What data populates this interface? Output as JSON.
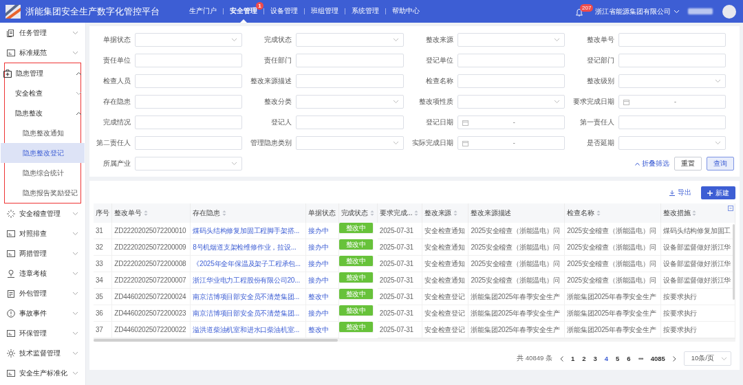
{
  "app": {
    "title": "浙能集团安全生产数字化管控平台"
  },
  "top_nav": [
    {
      "label": "生产门户",
      "selected": false
    },
    {
      "label": "安全管理",
      "selected": true,
      "badge": "1"
    },
    {
      "label": "设备管理",
      "selected": false
    },
    {
      "label": "班组管理",
      "selected": false
    },
    {
      "label": "系统管理",
      "selected": false
    },
    {
      "label": "帮助中心",
      "selected": false
    }
  ],
  "header_right": {
    "notification_count": "207",
    "company": "浙江省能源集团有限公司"
  },
  "sidebar": {
    "items": [
      {
        "label": "任务管理",
        "expanded": false
      },
      {
        "label": "标准规范",
        "expanded": false
      },
      {
        "label": "隐患管理",
        "expanded": true,
        "highlighted": true,
        "children": [
          {
            "label": "安全检查",
            "expanded": false
          },
          {
            "label": "隐患整改",
            "expanded": true,
            "children": [
              {
                "label": "隐患整改通知",
                "selected": false
              },
              {
                "label": "隐患整改登记",
                "selected": true
              },
              {
                "label": "隐患综合统计",
                "selected": false
              },
              {
                "label": "隐患报告奖励登记",
                "selected": false
              }
            ]
          }
        ]
      },
      {
        "label": "安全稽查管理",
        "expanded": false
      },
      {
        "label": "对照排查",
        "expanded": false
      },
      {
        "label": "两措管理",
        "expanded": false
      },
      {
        "label": "违章考核",
        "expanded": false
      },
      {
        "label": "外包管理",
        "expanded": false
      },
      {
        "label": "事故事件",
        "expanded": false
      },
      {
        "label": "环保管理",
        "expanded": false
      },
      {
        "label": "技术监督管理",
        "expanded": false
      },
      {
        "label": "安全生产标准化",
        "expanded": false
      }
    ]
  },
  "filters": {
    "fields": [
      {
        "label": "单据状态",
        "kind": "select"
      },
      {
        "label": "完成状态",
        "kind": "select"
      },
      {
        "label": "整改来源",
        "kind": "select"
      },
      {
        "label": "整改单号",
        "kind": "text"
      },
      {
        "label": "责任单位",
        "kind": "text"
      },
      {
        "label": "责任部门",
        "kind": "text"
      },
      {
        "label": "登记单位",
        "kind": "text"
      },
      {
        "label": "登记部门",
        "kind": "text"
      },
      {
        "label": "检查人员",
        "kind": "text"
      },
      {
        "label": "整改来源描述",
        "kind": "text"
      },
      {
        "label": "检查名称",
        "kind": "text"
      },
      {
        "label": "整改级别",
        "kind": "select"
      },
      {
        "label": "存在隐患",
        "kind": "text"
      },
      {
        "label": "整改分类",
        "kind": "select"
      },
      {
        "label": "整改项性质",
        "kind": "select"
      },
      {
        "label": "要求完成日期",
        "kind": "date",
        "separator": "-"
      },
      {
        "label": "完成情况",
        "kind": "text"
      },
      {
        "label": "登记人",
        "kind": "text"
      },
      {
        "label": "登记日期",
        "kind": "date",
        "separator": "-"
      },
      {
        "label": "第一责任人",
        "kind": "text"
      },
      {
        "label": "第二责任人",
        "kind": "text"
      },
      {
        "label": "管理隐患类别",
        "kind": "select"
      },
      {
        "label": "实际完成日期",
        "kind": "date",
        "separator": "-"
      },
      {
        "label": "是否延期",
        "kind": "select"
      },
      {
        "label": "所属产业",
        "kind": "select"
      }
    ],
    "collapse_link": "折叠筛选",
    "buttons": [
      {
        "label": "重置",
        "kind": "default"
      },
      {
        "label": "查询",
        "kind": "primary"
      }
    ]
  },
  "table": {
    "toolbar": {
      "export": "导出",
      "create": "新建"
    },
    "columns": [
      {
        "label": "序号",
        "sortable": false,
        "kind": "text"
      },
      {
        "label": "整改单号",
        "sortable": true,
        "kind": "text"
      },
      {
        "label": "存在隐患",
        "sortable": true,
        "kind": "link"
      },
      {
        "label": "单据状态",
        "sortable": false,
        "kind": "status"
      },
      {
        "label": "完成状态",
        "sortable": true,
        "kind": "tag"
      },
      {
        "label": "要求完成...",
        "sortable": true,
        "kind": "text"
      },
      {
        "label": "整改来源",
        "sortable": true,
        "kind": "text"
      },
      {
        "label": "整改来源描述",
        "sortable": false,
        "kind": "text"
      },
      {
        "label": "检查名称",
        "sortable": true,
        "kind": "text"
      },
      {
        "label": "整改措施",
        "sortable": true,
        "kind": "text"
      }
    ],
    "rows": [
      [
        "31",
        "ZD22202025072200010",
        "煤码头结构修复加固工程脚手架搭...",
        "接办中",
        "整改中",
        "2025-07-31",
        "安全检查通知",
        "2025安全稽查（浙能温电）问",
        "2025安全稽查（浙能温电）问",
        "煤码头结构修复加固工"
      ],
      [
        "32",
        "ZD22202025072200009",
        "8号机烟道支架检维修作业，拉设...",
        "接办中",
        "整改中",
        "2025-07-31",
        "安全检查通知",
        "2025安全稽查（浙能温电）问",
        "2025安全稽查（浙能温电）问",
        "设备部监督做好浙江华"
      ],
      [
        "33",
        "ZD22202025072200008",
        "《2025年全年保温及架子工程承包...",
        "接办中",
        "整改中",
        "2025-07-31",
        "安全检查通知",
        "2025安全稽查（浙能温电）问",
        "2025安全稽查（浙能温电）问",
        "设备部监督做好浙江华"
      ],
      [
        "34",
        "ZD22202025072200007",
        "浙江华业电力工程股份有限公司20...",
        "接办中",
        "整改中",
        "2025-07-31",
        "安全检查通知",
        "2025安全稽查（浙能温电）问",
        "2025安全稽查（浙能温电）问",
        "设备部监督做好浙江华"
      ],
      [
        "35",
        "ZD44602025072200024",
        "南京洁博项目部安全员不清楚集团...",
        "整改中",
        "整改中",
        "2025-07-31",
        "安全检查登记",
        "浙能集团2025年春季安全生产",
        "浙能集团2025年春季安全生产",
        "按要求执行"
      ],
      [
        "36",
        "ZD44602025072200023",
        "南京洁博项目部安全员不清楚集团...",
        "接办中",
        "整改中",
        "2025-07-31",
        "安全检查登记",
        "浙能集团2025年春季安全生产",
        "浙能集团2025年春季安全生产",
        "按要求执行"
      ],
      [
        "37",
        "ZD44602025072200022",
        "溢洪道柴油机室和进水口柴油机室...",
        "整改中",
        "整改中",
        "2025-07-31",
        "安全检查登记",
        "浙能集团2025年春季安全生产",
        "浙能集团2025年春季安全生产",
        "按要求执行"
      ]
    ]
  },
  "pagination": {
    "total": "共 40849 条",
    "pages": [
      {
        "label": "1",
        "kind": "page",
        "selected": false
      },
      {
        "label": "2",
        "kind": "page",
        "selected": false
      },
      {
        "label": "3",
        "kind": "page",
        "selected": false
      },
      {
        "label": "4",
        "kind": "page",
        "selected": true
      },
      {
        "label": "5",
        "kind": "page",
        "selected": false
      },
      {
        "label": "6",
        "kind": "page",
        "selected": false
      },
      {
        "label": "•••",
        "kind": "ellipsis",
        "selected": false
      },
      {
        "label": "4085",
        "kind": "page",
        "selected": false
      }
    ],
    "page_size": "10条/页"
  }
}
